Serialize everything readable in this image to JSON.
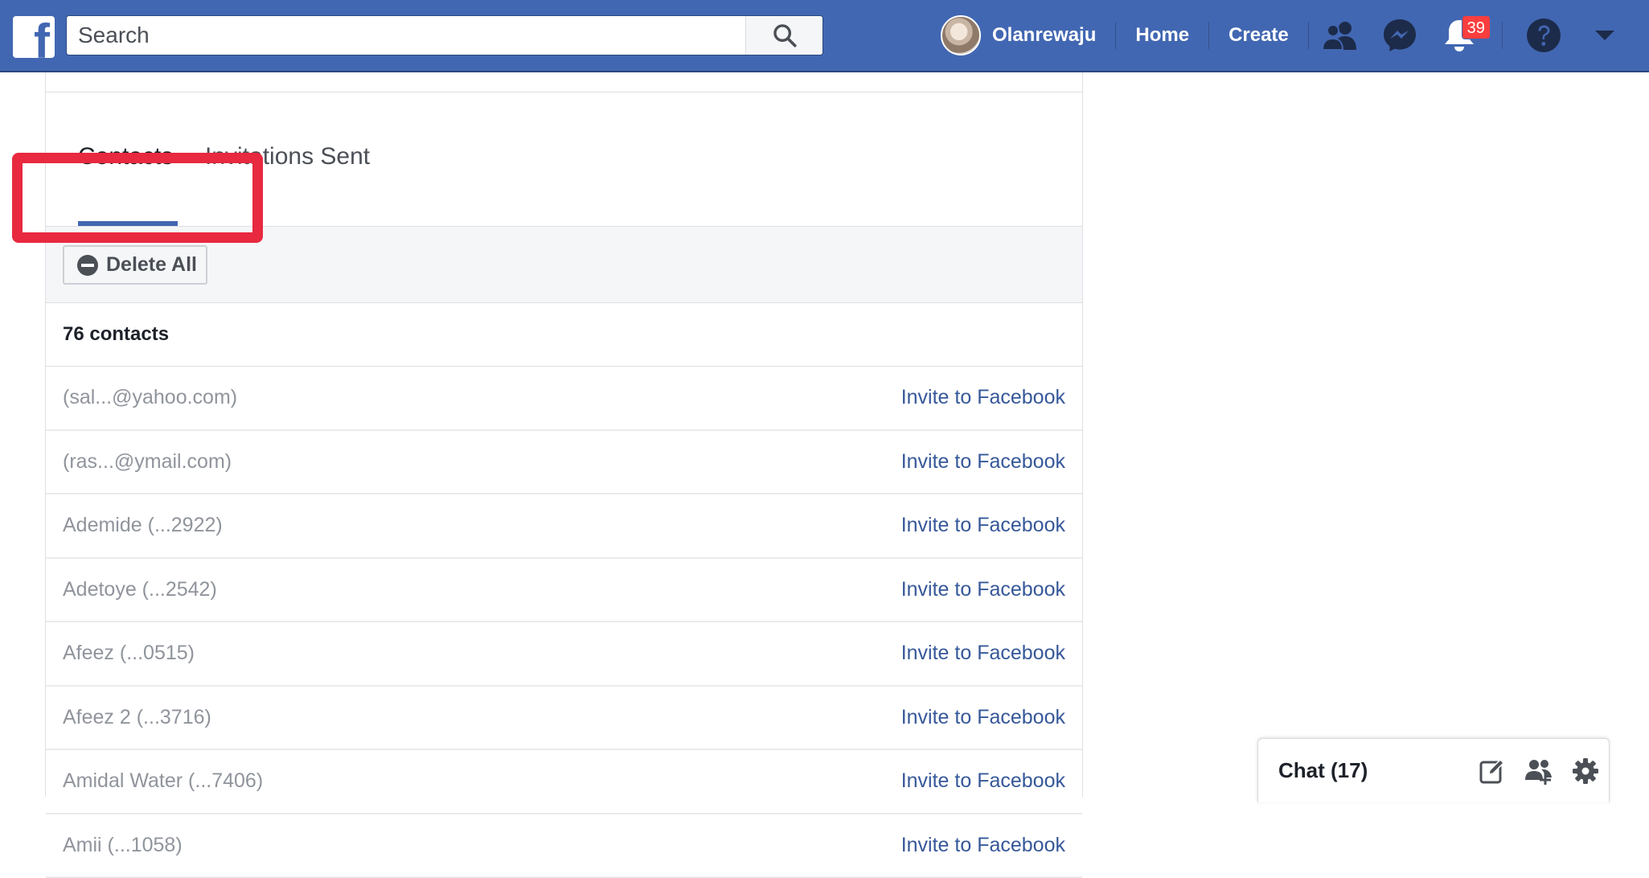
{
  "topbar": {
    "logo": "f",
    "search_placeholder": "Search",
    "user_name": "Olanrewaju",
    "nav_home": "Home",
    "nav_create": "Create",
    "notification_count": "39",
    "icons": [
      "search-icon",
      "friends-icon",
      "messenger-icon",
      "bell-icon",
      "help-icon",
      "caret-down-icon"
    ],
    "brand_color": "#4267b2"
  },
  "tabs": [
    {
      "label": "Contacts",
      "active": true
    },
    {
      "label": "Invitations Sent",
      "active": false
    }
  ],
  "toolbar": {
    "delete_all_label": "Delete All"
  },
  "contacts": {
    "count_label": "76 contacts",
    "invite_label": "Invite to Facebook",
    "rows": [
      "(sal...@yahoo.com)",
      "(ras...@ymail.com)",
      "Ademide (...2922)",
      "Adetoye (...2542)",
      "Afeez (...0515)",
      "Afeez 2 (...3716)",
      "Amidal Water (...7406)",
      "Amii (...1058)"
    ]
  },
  "chat": {
    "title": "Chat (17)",
    "icons": [
      "compose-icon",
      "group-add-icon",
      "gear-icon"
    ]
  },
  "annotation": {
    "highlight_color": "#e8293f"
  }
}
